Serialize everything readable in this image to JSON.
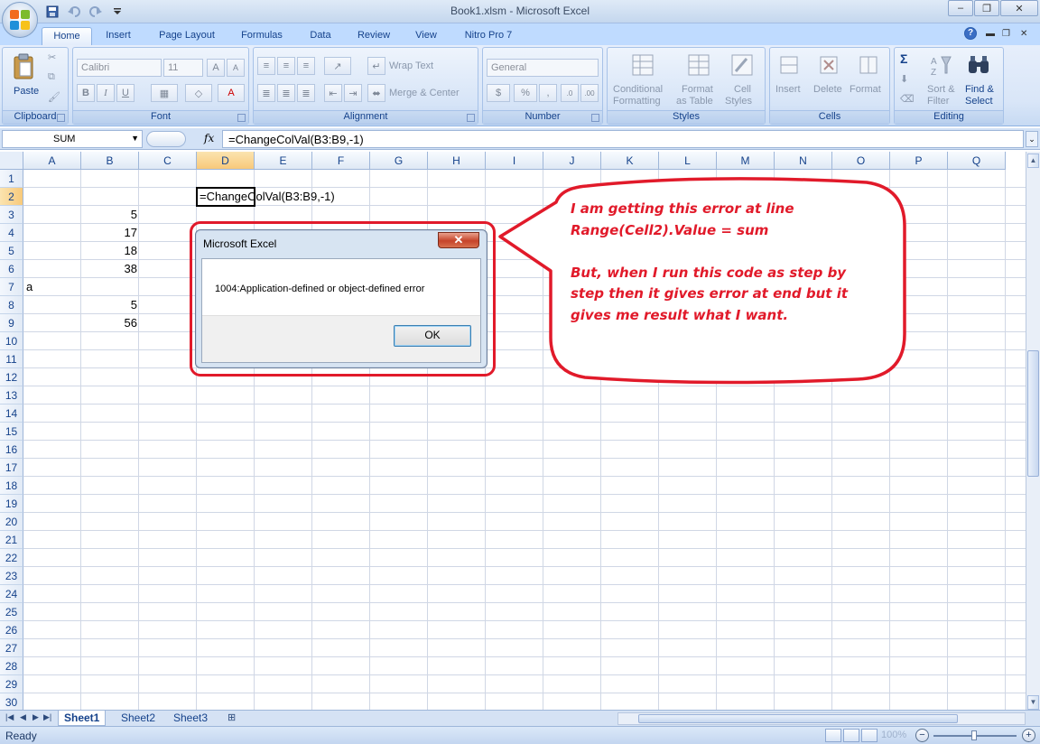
{
  "window": {
    "title": "Book1.xlsm - Microsoft Excel",
    "controls": [
      "–",
      "❐",
      "✕"
    ]
  },
  "tabs": [
    "Home",
    "Insert",
    "Page Layout",
    "Formulas",
    "Data",
    "Review",
    "View",
    "Nitro Pro 7"
  ],
  "ribbon": {
    "clipboard": {
      "paste": "Paste",
      "label": "Clipboard"
    },
    "font": {
      "name": "Calibri",
      "size": "11",
      "bold": "B",
      "italic": "I",
      "underline": "U",
      "label": "Font"
    },
    "alignment": {
      "wrap": "Wrap Text",
      "merge": "Merge & Center",
      "label": "Alignment"
    },
    "number": {
      "format": "General",
      "currency": "$",
      "percent": "%",
      "comma": ",",
      "label": "Number"
    },
    "styles": {
      "cond1": "Conditional",
      "cond2": "Formatting",
      "fmt1": "Format",
      "fmt2": "as Table",
      "cell1": "Cell",
      "cell2": "Styles",
      "label": "Styles"
    },
    "cells": {
      "insert": "Insert",
      "delete": "Delete",
      "format": "Format",
      "label": "Cells"
    },
    "editing": {
      "sum": "Σ",
      "sort1": "Sort &",
      "sort2": "Filter",
      "find1": "Find &",
      "find2": "Select",
      "label": "Editing"
    }
  },
  "formula_bar": {
    "name_box": "SUM",
    "fx": "fx",
    "formula": "=ChangeColVal(B3:B9,-1)"
  },
  "grid": {
    "columns": [
      "A",
      "B",
      "C",
      "D",
      "E",
      "F",
      "G",
      "H",
      "I",
      "J",
      "K",
      "L",
      "M",
      "N",
      "O",
      "P",
      "Q"
    ],
    "rows": [
      "1",
      "2",
      "3",
      "4",
      "5",
      "6",
      "7",
      "8",
      "9",
      "10",
      "11",
      "12",
      "13",
      "14",
      "15",
      "16",
      "17",
      "18",
      "19",
      "20",
      "21",
      "22",
      "23",
      "24",
      "25",
      "26",
      "27",
      "28",
      "29",
      "30"
    ],
    "selected_column": "D",
    "selected_row": "2",
    "cells": {
      "D2": "=ChangeColVal(B3:B9,-1)",
      "B3": "5",
      "B4": "17",
      "B5": "18",
      "B6": "38",
      "A7": "a",
      "B8": "5",
      "B9": "56"
    }
  },
  "sheets": [
    "Sheet1",
    "Sheet2",
    "Sheet3"
  ],
  "status": {
    "text": "Ready",
    "zoom": "100%",
    "minus": "−",
    "plus": "+"
  },
  "dialog": {
    "title": "Microsoft Excel",
    "close": "✕",
    "message": "1004:Application-defined or object-defined error",
    "ok": "OK"
  },
  "callout": {
    "line1": "I am getting this error at line",
    "line2": "Range(Cell2).Value = sum",
    "line3": "But, when I run this code as step by",
    "line4": "step then it gives error at end but it",
    "line5": "gives me result what I want."
  },
  "colors": {
    "accent": "#15428b",
    "annotation": "#e11a2a",
    "selection": "#f8c97a"
  }
}
